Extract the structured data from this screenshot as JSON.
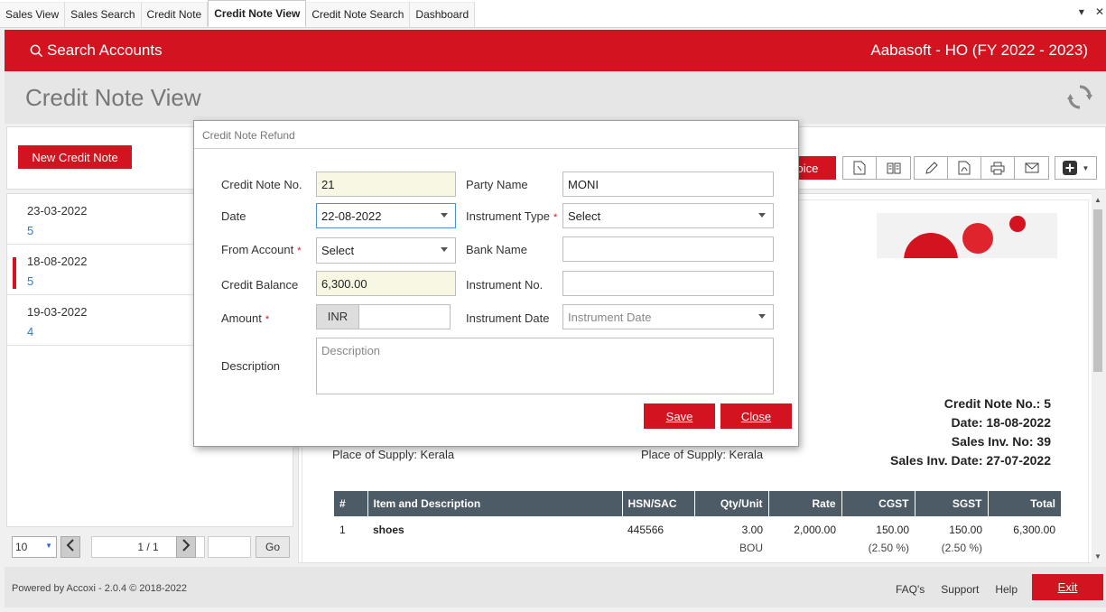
{
  "tabs": [
    {
      "label": "Sales View"
    },
    {
      "label": "Sales Search"
    },
    {
      "label": "Credit Note"
    },
    {
      "label": "Credit Note View",
      "active": true
    },
    {
      "label": "Credit Note Search"
    },
    {
      "label": "Dashboard"
    }
  ],
  "tab_controls": {
    "dropdown": "▾",
    "close": "✕"
  },
  "header": {
    "search_label": "Search Accounts",
    "company": "Aabasoft - HO (FY 2022 - 2023)",
    "brand_color": "#d3131f"
  },
  "page_title": "Credit Note View",
  "left": {
    "new_button": "New Credit Note",
    "items": [
      {
        "date": "23-03-2022",
        "number": "5"
      },
      {
        "date": "18-08-2022",
        "number": "5",
        "selected": true
      },
      {
        "date": "19-03-2022",
        "number": "4"
      }
    ],
    "pager": {
      "page_size": "10",
      "page_info": "1 / 1",
      "go": "Go"
    }
  },
  "toolbar": {
    "invoice_partial": "voice",
    "icons": [
      "new-document-icon",
      "book-icon",
      "edit-icon",
      "pdf-icon",
      "print-icon",
      "mail-icon",
      "plus-icon"
    ]
  },
  "document": {
    "credit_note_no": "Credit Note No.: 5",
    "date": "Date: 18-08-2022",
    "sales_inv_no": "Sales Inv. No: 39",
    "sales_inv_date": "Sales Inv. Date: 27-07-2022",
    "place_of_supply_left": "Place of Supply: Kerala",
    "place_of_supply_right": "Place of Supply: Kerala",
    "table": {
      "headers": [
        "#",
        "Item and Description",
        "HSN/SAC",
        "Qty/Unit",
        "Rate",
        "CGST",
        "SGST",
        "Total"
      ],
      "rows": [
        {
          "no": "1",
          "item": "shoes",
          "hsn": "445566",
          "qty": "3.00",
          "unit": "BOU",
          "rate": "2,000.00",
          "cgst": "150.00",
          "cgst_pct": "(2.50 %)",
          "sgst": "150.00",
          "sgst_pct": "(2.50 %)",
          "total": "6,300.00"
        }
      ]
    }
  },
  "modal": {
    "title": "Credit Note Refund",
    "fields": {
      "credit_note_no": {
        "label": "Credit Note No.",
        "value": "21"
      },
      "date": {
        "label": "Date",
        "value": "22-08-2022"
      },
      "from_account": {
        "label": "From Account",
        "value": "Select"
      },
      "credit_balance": {
        "label": "Credit Balance",
        "value": "6,300.00"
      },
      "amount": {
        "label": "Amount",
        "currency": "INR",
        "value": ""
      },
      "description": {
        "label": "Description",
        "placeholder": "Description"
      },
      "party_name": {
        "label": "Party Name",
        "value": "MONI"
      },
      "instrument_type": {
        "label": "Instrument Type",
        "value": "Select"
      },
      "bank_name": {
        "label": "Bank Name",
        "value": ""
      },
      "instrument_no": {
        "label": "Instrument No.",
        "value": ""
      },
      "instrument_date": {
        "label": "Instrument Date",
        "placeholder": "Instrument Date"
      }
    },
    "required_mark": "*",
    "save": "Save",
    "close": "Close"
  },
  "footer": {
    "powered": "Powered by Accoxi - 2.0.4 © 2018-2022",
    "links": [
      "FAQ's",
      "Support",
      "Help"
    ],
    "exit": "Exit"
  }
}
